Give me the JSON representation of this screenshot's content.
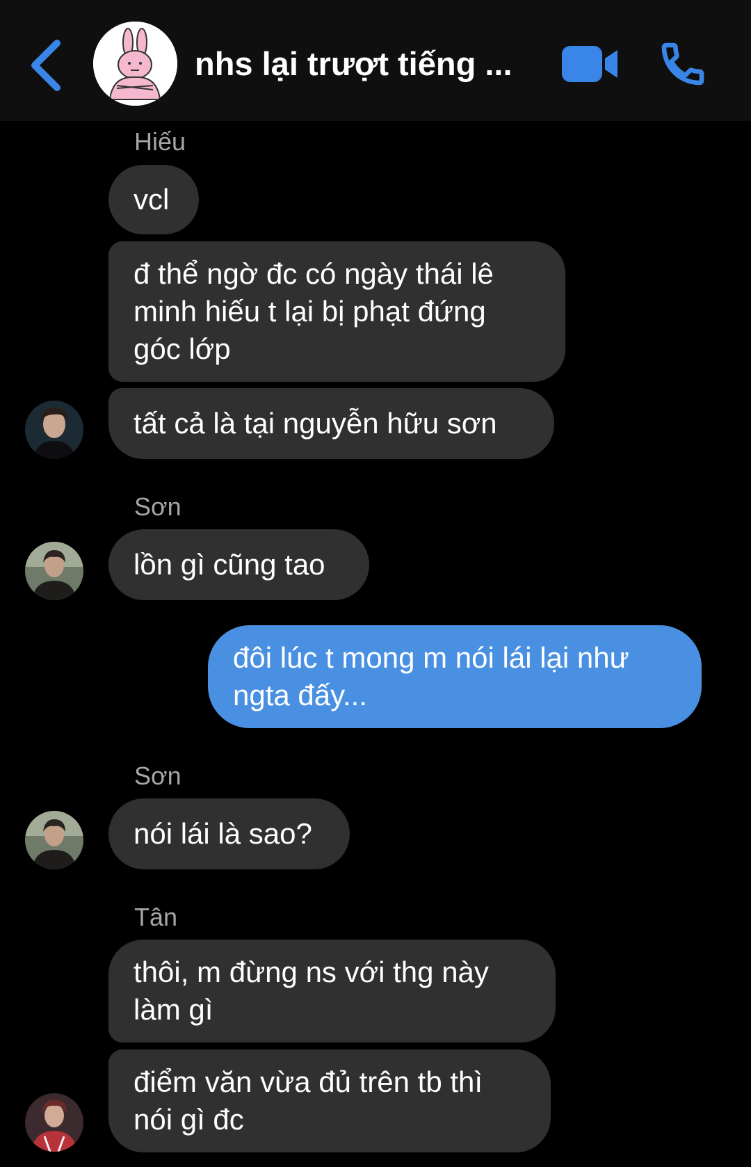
{
  "header": {
    "title": "nhs lại trượt tiếng ...",
    "accent_color": "#3a86e8",
    "back_icon": "chevron-left-icon",
    "video_icon": "video-camera-icon",
    "call_icon": "phone-icon"
  },
  "messages": [
    {
      "sender": "Hiếu",
      "text": "vcl"
    },
    {
      "text": "đ thể ngờ đc có ngày thái lê minh hiếu t lại bị phạt đứng góc lớp"
    },
    {
      "text": "tất cả là tại nguyễn hữu sơn"
    },
    {
      "sender": "Sơn",
      "text": "lồn gì cũng tao"
    },
    {
      "text": "đôi lúc t mong m nói lái lại như ngta đấy...",
      "outgoing": true
    },
    {
      "sender": "Sơn",
      "text": "nói lái là sao?"
    },
    {
      "sender": "Tân",
      "text": "thôi, m đừng ns với thg này làm gì"
    },
    {
      "text": "điểm văn vừa đủ trên tb thì nói gì đc"
    }
  ],
  "colors": {
    "incoming_bubble": "#303030",
    "outgoing_bubble": "#4a90e2",
    "background": "#000000"
  }
}
